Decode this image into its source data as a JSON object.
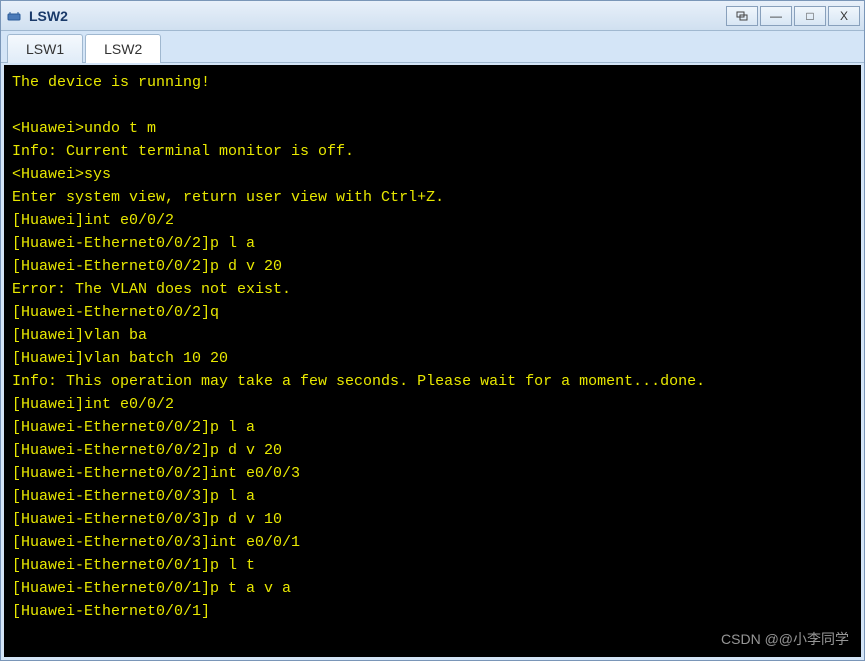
{
  "window": {
    "title": "LSW2",
    "icon_name": "app-icon"
  },
  "titlebar_buttons": {
    "popout": "⮹",
    "minimize": "—",
    "maximize": "□",
    "close": "X"
  },
  "tabs": [
    {
      "label": "LSW1",
      "active": false
    },
    {
      "label": "LSW2",
      "active": true
    }
  ],
  "terminal_lines": [
    "The device is running!",
    "",
    "<Huawei>undo t m",
    "Info: Current terminal monitor is off.",
    "<Huawei>sys",
    "Enter system view, return user view with Ctrl+Z.",
    "[Huawei]int e0/0/2",
    "[Huawei-Ethernet0/0/2]p l a",
    "[Huawei-Ethernet0/0/2]p d v 20",
    "Error: The VLAN does not exist.",
    "[Huawei-Ethernet0/0/2]q",
    "[Huawei]vlan ba",
    "[Huawei]vlan batch 10 20",
    "Info: This operation may take a few seconds. Please wait for a moment...done.",
    "[Huawei]int e0/0/2",
    "[Huawei-Ethernet0/0/2]p l a",
    "[Huawei-Ethernet0/0/2]p d v 20",
    "[Huawei-Ethernet0/0/2]int e0/0/3",
    "[Huawei-Ethernet0/0/3]p l a",
    "[Huawei-Ethernet0/0/3]p d v 10",
    "[Huawei-Ethernet0/0/3]int e0/0/1",
    "[Huawei-Ethernet0/0/1]p l t",
    "[Huawei-Ethernet0/0/1]p t a v a",
    "[Huawei-Ethernet0/0/1]"
  ],
  "watermark": "CSDN @@小李同学"
}
